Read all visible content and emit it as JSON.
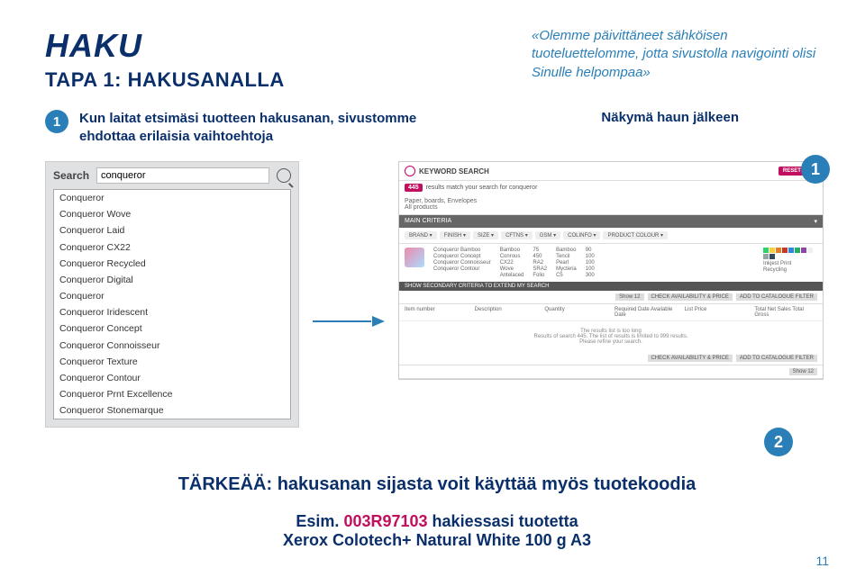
{
  "header": {
    "title": "HAKU",
    "subtitle": "TAPA 1: HAKUSANALLA",
    "quote": "«Olemme päivittäneet sähköisen tuoteluettelomme, jotta sivustolla navigointi olisi Sinulle helpompaa»"
  },
  "step1": {
    "number": "1",
    "text": "Kun laitat etsimäsi tuotteen hakusanan, sivustomme ehdottaa erilaisia vaihtoehtoja",
    "after_label": "Näkymä haun jälkeen"
  },
  "search": {
    "label": "Search",
    "value": "conqueror",
    "suggestions": [
      "Conqueror",
      "Conqueror Wove",
      "Conqueror Laid",
      "Conqueror CX22",
      "Conqueror Recycled",
      "Conqueror Digital",
      "Conqueror",
      "Conqueror Iridescent",
      "Conqueror Concept",
      "Conqueror Connoisseur",
      "Conqueror Texture",
      "Conqueror Contour",
      "Conqueror Prnt Excellence",
      "Conqueror Stonemarque"
    ]
  },
  "results": {
    "keyword_label": "KEYWORD SEARCH",
    "reset": "RESET ALL",
    "count_badge": "445",
    "count_text": "results match your search for conqueror",
    "sub_cat": "Paper, boards, Envelopes",
    "sub_count": "All products",
    "main_criteria": "MAIN CRITERIA",
    "filters": [
      "BRAND",
      "FINISH",
      "SIZE",
      "CFTNS",
      "GSM",
      "COLINFO",
      "PRODUCT COLOUR"
    ],
    "brands": [
      "Conqueror Bamboo",
      "Conqueror Concept",
      "Conqueror Connoisseur",
      "Conqueror Contour"
    ],
    "finishes": [
      "Bamboo",
      "Conrous",
      "CX22",
      "Wove",
      "Antelaced"
    ],
    "sizes": [
      "75",
      "450",
      "RA2",
      "SRA2",
      "Folio"
    ],
    "ctns": [
      "Bamboo",
      "Tencil",
      "Pearl",
      "Mycteria",
      "C5"
    ],
    "gsms": [
      "90",
      "100",
      "100",
      "100",
      "300"
    ],
    "col_items": [
      "Inkjest Print",
      "Recycling"
    ],
    "swatch_colors": [
      "#2bd36a",
      "#f4d03f",
      "#e67e22",
      "#c0392b",
      "#2e86de",
      "#27ae60",
      "#8e44ad",
      "#ecf0f1",
      "#95a5a6",
      "#34495e"
    ],
    "secondary_bar": "SHOW SECONDARY CRITERIA TO EXTEND MY SEARCH",
    "btn_show": "Show 12",
    "btn_check": "CHECK AVAILABILITY & PRICE",
    "btn_add": "ADD TO CATALOGUE FILTER",
    "table_head": [
      "Item number",
      "Description",
      "Quantity",
      "Required Date Available Date",
      "List Price",
      "Total Net Sales Total Gross"
    ],
    "empty1": "The results list is too long",
    "empty2": "Results of search 445. The list of results is limited to 999 results.",
    "empty3": "Please refine your search."
  },
  "right_marker": "1",
  "two_marker": "2",
  "important": {
    "line": "TÄRKEÄÄ: hakusanan sijasta voit käyttää myös tuotekoodia"
  },
  "example": {
    "prefix": "Esim.",
    "code": "003R97103",
    "mid": "hakiessasi tuotetta",
    "product": "Xerox Colotech+ Natural White 100 g A3"
  },
  "page_number": "11"
}
